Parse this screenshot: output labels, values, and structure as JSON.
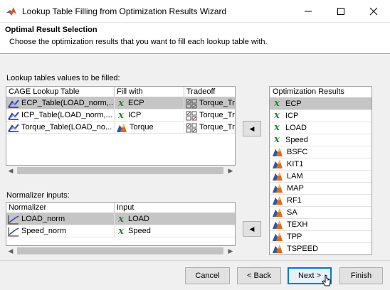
{
  "window": {
    "title": "Lookup Table Filling from Optimization Results Wizard",
    "icons": {
      "app": "matlab-icon",
      "minimize": "minimize-icon",
      "maximize": "maximize-icon",
      "close": "close-icon"
    }
  },
  "header": {
    "title": "Optimal Result Selection",
    "description": "Choose the optimization results that you want to fill each lookup table with."
  },
  "lookup_tables": {
    "label": "Lookup tables values to be filled:",
    "columns": [
      "CAGE Lookup Table",
      "Fill with",
      "Tradeoff"
    ],
    "rows": [
      {
        "table": "ECP_Table(LOAD_norm,...",
        "table_icon": "lookup-table-icon",
        "fill": "ECP",
        "fill_icon": "variable-x-icon",
        "tradeoff": "Torque_Tr",
        "tradeoff_icon": "tradeoff-icon",
        "selected": true
      },
      {
        "table": "ICP_Table(LOAD_norm,...",
        "table_icon": "lookup-table-icon",
        "fill": "ICP",
        "fill_icon": "variable-x-icon",
        "tradeoff": "Torque_Tr",
        "tradeoff_icon": "tradeoff-icon",
        "selected": false
      },
      {
        "table": "Torque_Table(LOAD_no...",
        "table_icon": "lookup-table-icon",
        "fill": "Torque",
        "fill_icon": "model-icon",
        "tradeoff": "Torque_Tr",
        "tradeoff_icon": "tradeoff-icon",
        "selected": false
      }
    ]
  },
  "normalizers": {
    "label": "Normalizer inputs:",
    "columns": [
      "Normalizer",
      "Input"
    ],
    "rows": [
      {
        "normalizer": "LOAD_norm",
        "normalizer_icon": "normalizer-icon",
        "input": "LOAD",
        "input_icon": "variable-x-icon",
        "selected": true
      },
      {
        "normalizer": "Speed_norm",
        "normalizer_icon": "normalizer-icon",
        "input": "Speed",
        "input_icon": "variable-x-icon",
        "selected": false
      }
    ]
  },
  "optimization_results": {
    "header": "Optimization Results",
    "items": [
      {
        "label": "ECP",
        "icon": "variable-x-icon",
        "selected": true
      },
      {
        "label": "ICP",
        "icon": "variable-x-icon",
        "selected": false
      },
      {
        "label": "LOAD",
        "icon": "variable-x-icon",
        "selected": false
      },
      {
        "label": "Speed",
        "icon": "variable-x-icon",
        "selected": false
      },
      {
        "label": "BSFC",
        "icon": "model-icon",
        "selected": false
      },
      {
        "label": "KIT1",
        "icon": "model-icon",
        "selected": false
      },
      {
        "label": "LAM",
        "icon": "model-icon",
        "selected": false
      },
      {
        "label": "MAP",
        "icon": "model-icon",
        "selected": false
      },
      {
        "label": "RF1",
        "icon": "model-icon",
        "selected": false
      },
      {
        "label": "SA",
        "icon": "model-icon",
        "selected": false
      },
      {
        "label": "TEXH",
        "icon": "model-icon",
        "selected": false
      },
      {
        "label": "TPP",
        "icon": "model-icon",
        "selected": false
      },
      {
        "label": "TSPEED",
        "icon": "model-icon",
        "selected": false
      }
    ]
  },
  "buttons": {
    "assign_table": "◀",
    "assign_normalizer": "◀",
    "cancel": "Cancel",
    "back": "< Back",
    "next": "Next >",
    "finish": "Finish"
  },
  "colors": {
    "selection": "#c5c5c5",
    "variable_green": "#1a8a2a",
    "default_button_border": "#0078d7"
  }
}
